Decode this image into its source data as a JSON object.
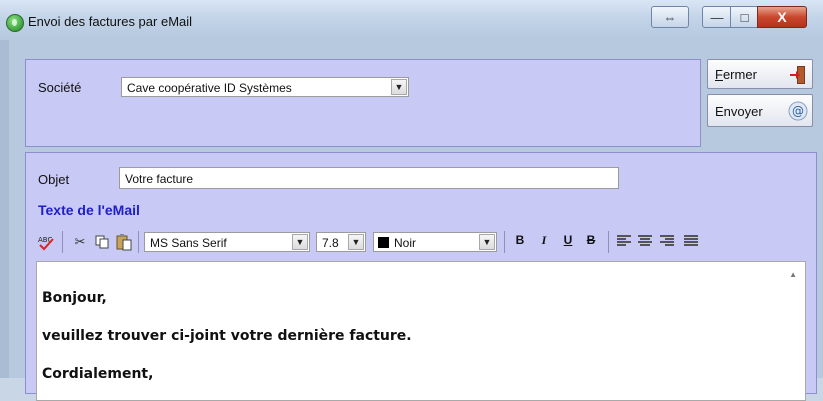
{
  "window": {
    "title": "Envoi des factures par eMail"
  },
  "titlebar_buttons": {
    "back": "⇔",
    "minimize": "—",
    "maximize": "□",
    "close": "X"
  },
  "company": {
    "label": "Société",
    "value": "Cave coopérative ID Systèmes"
  },
  "actions": {
    "close_label_first": "F",
    "close_label_rest": "ermer",
    "send_label": "Envoyer"
  },
  "email": {
    "subject_label": "Objet",
    "subject_value": "Votre facture",
    "body_title": "Texte de l'eMail",
    "font_name": "MS Sans Serif",
    "font_size": "7.8",
    "color_name": "Noir",
    "format": {
      "bold": "B",
      "italic": "I",
      "underline": "U",
      "strike": "B"
    },
    "body_lines": [
      "Bonjour,",
      "veuillez trouver ci-joint votre dernière facture.",
      "Cordialement,"
    ]
  },
  "colors": {
    "panel": "#c8c9f4",
    "title_accent": "#2020c8",
    "close_button": "#c8482e"
  }
}
